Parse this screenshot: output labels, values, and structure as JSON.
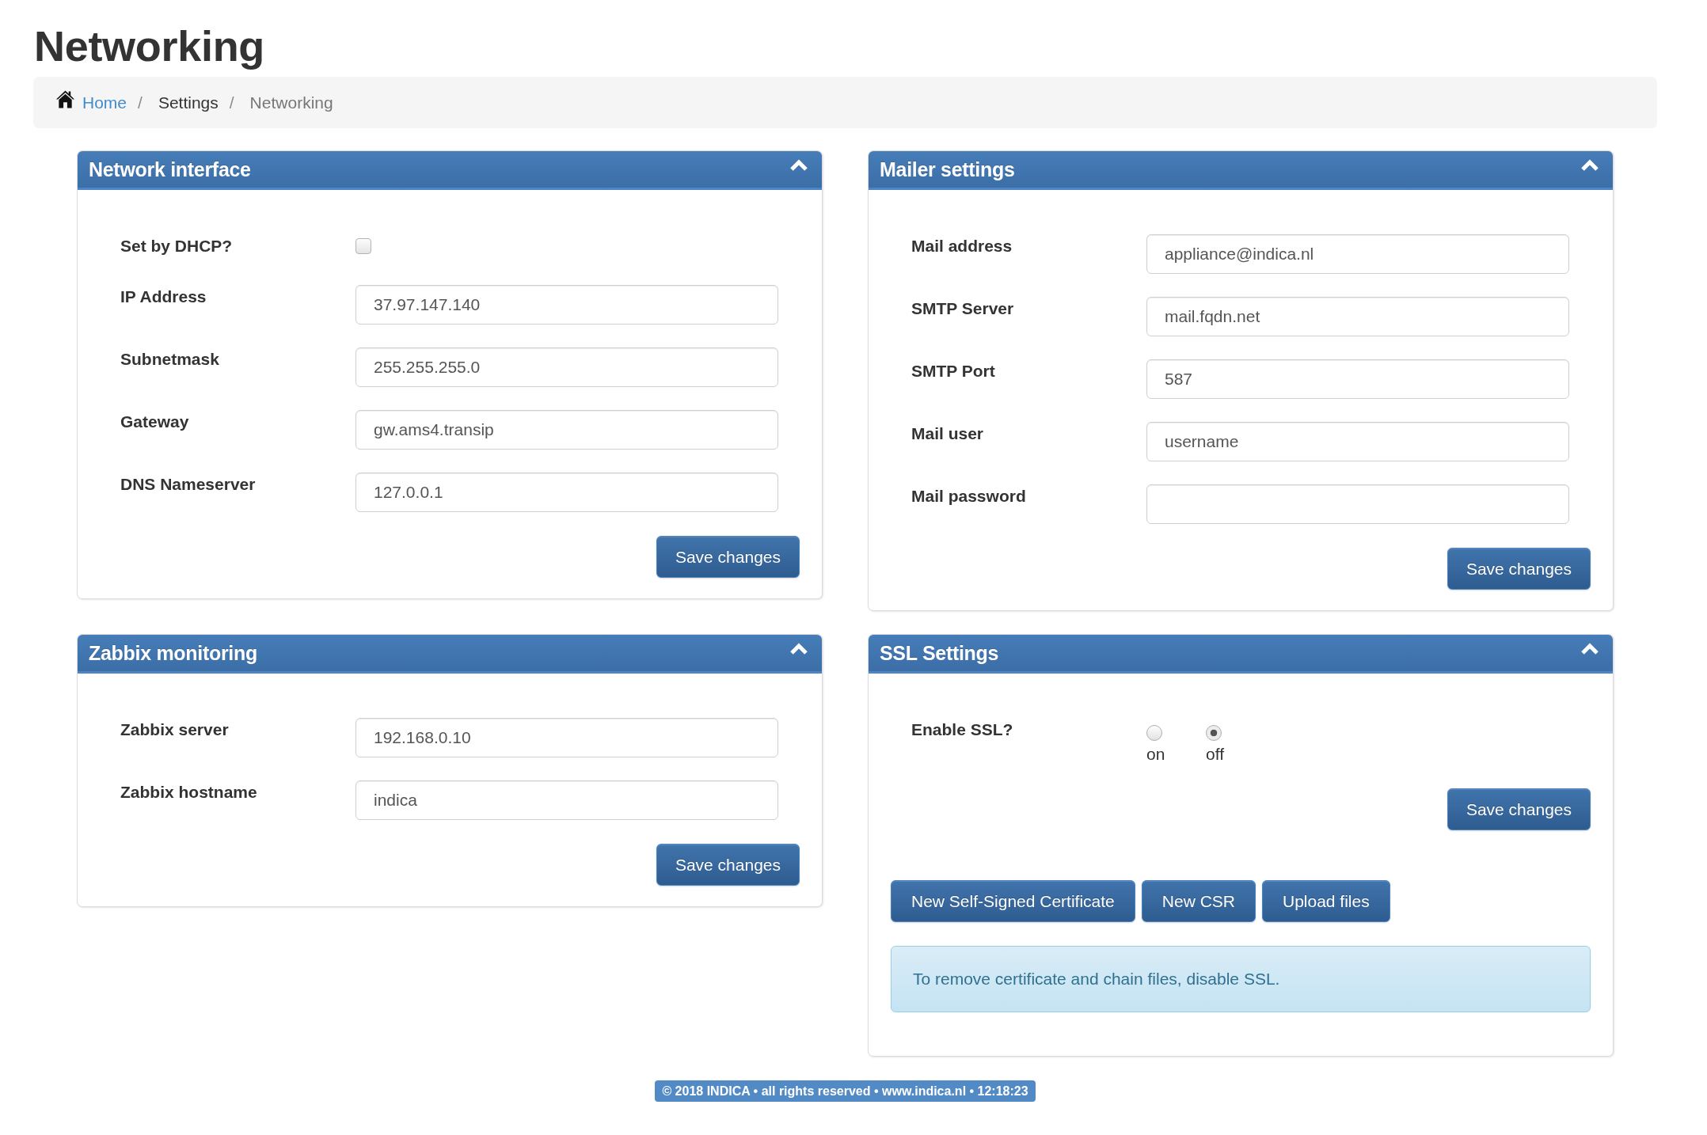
{
  "page_title": "Networking",
  "breadcrumb": [
    {
      "kind": "link",
      "label": "Home"
    },
    {
      "kind": "separator",
      "label": "/"
    },
    {
      "kind": "text",
      "label": "Settings"
    },
    {
      "kind": "separator",
      "label": "/"
    },
    {
      "kind": "current",
      "label": "Networking"
    }
  ],
  "panels": [
    {
      "title": "Network interface",
      "expanded": true,
      "fields": [
        {
          "kind": "checkbox",
          "label": "Set by DHCP?",
          "checked": false
        },
        {
          "kind": "text",
          "label": "IP Address",
          "value": "37.97.147.140"
        },
        {
          "kind": "text",
          "label": "Subnetmask",
          "value": "255.255.255.0"
        },
        {
          "kind": "text",
          "label": "Gateway",
          "value": "gw.ams4.transip"
        },
        {
          "kind": "text",
          "label": "DNS Nameserver",
          "value": "127.0.0.1"
        }
      ],
      "save_button": "Save changes"
    },
    {
      "title": "Mailer settings",
      "expanded": true,
      "fields": [
        {
          "kind": "text",
          "label": "Mail address",
          "value": "appliance@indica.nl"
        },
        {
          "kind": "text",
          "label": "SMTP Server",
          "value": "mail.fqdn.net"
        },
        {
          "kind": "text",
          "label": "SMTP Port",
          "value": "587"
        },
        {
          "kind": "text",
          "label": "Mail user",
          "value": "username"
        },
        {
          "kind": "password",
          "label": "Mail password"
        }
      ],
      "save_button": "Save changes"
    },
    {
      "title": "Zabbix monitoring",
      "expanded": true,
      "fields": [
        {
          "kind": "text",
          "label": "Zabbix server",
          "value": "192.168.0.10"
        },
        {
          "kind": "text",
          "label": "Zabbix hostname",
          "value": "indica"
        }
      ],
      "save_button": "Save changes"
    },
    {
      "title": "SSL Settings",
      "expanded": true,
      "fields": [
        {
          "kind": "radio",
          "label": "Enable SSL?",
          "options": [
            {
              "label": "on",
              "selected": false
            },
            {
              "label": "off",
              "selected": true
            }
          ]
        }
      ],
      "save_button": "Save changes",
      "actions": [
        "New Self-Signed Certificate",
        "New CSR",
        "Upload files"
      ],
      "alert": "To remove certificate and chain files, disable SSL."
    }
  ],
  "footer": "© 2018 INDICA • all rights reserved • www.indica.nl • 12:18:23"
}
